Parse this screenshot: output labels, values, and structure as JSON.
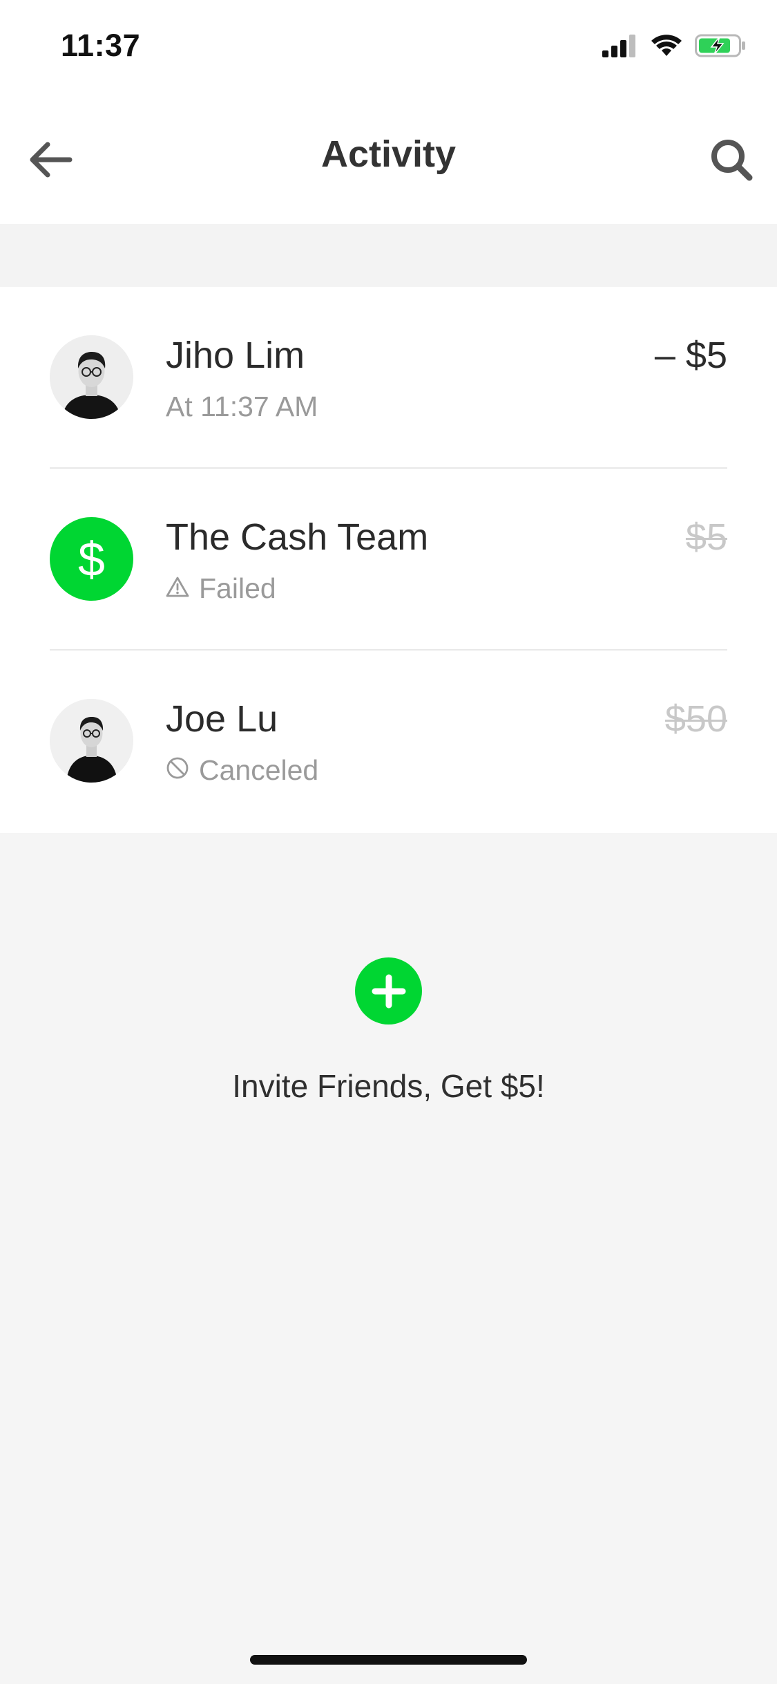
{
  "status_bar": {
    "time": "11:37"
  },
  "nav": {
    "title": "Activity"
  },
  "activity": [
    {
      "name": "Jiho Lim",
      "sub": "At 11:37 AM",
      "amount": "– $5",
      "status_icon": "none",
      "avatar": "profile-photo"
    },
    {
      "name": "The Cash Team",
      "sub": "Failed",
      "amount": "$5",
      "status_icon": "warning-icon",
      "avatar": "dollar-icon",
      "avatar_glyph": "$"
    },
    {
      "name": "Joe Lu",
      "sub": "Canceled",
      "amount": "$50",
      "status_icon": "canceled-icon",
      "avatar": "profile-photo"
    }
  ],
  "invite": {
    "label": "Invite Friends, Get $5!"
  },
  "colors": {
    "brand_green": "#00d632",
    "text_primary": "#2b2b2b",
    "text_secondary": "#9a9a9a",
    "struck_amount": "#c8c8c8",
    "background": "#f5f5f5"
  }
}
